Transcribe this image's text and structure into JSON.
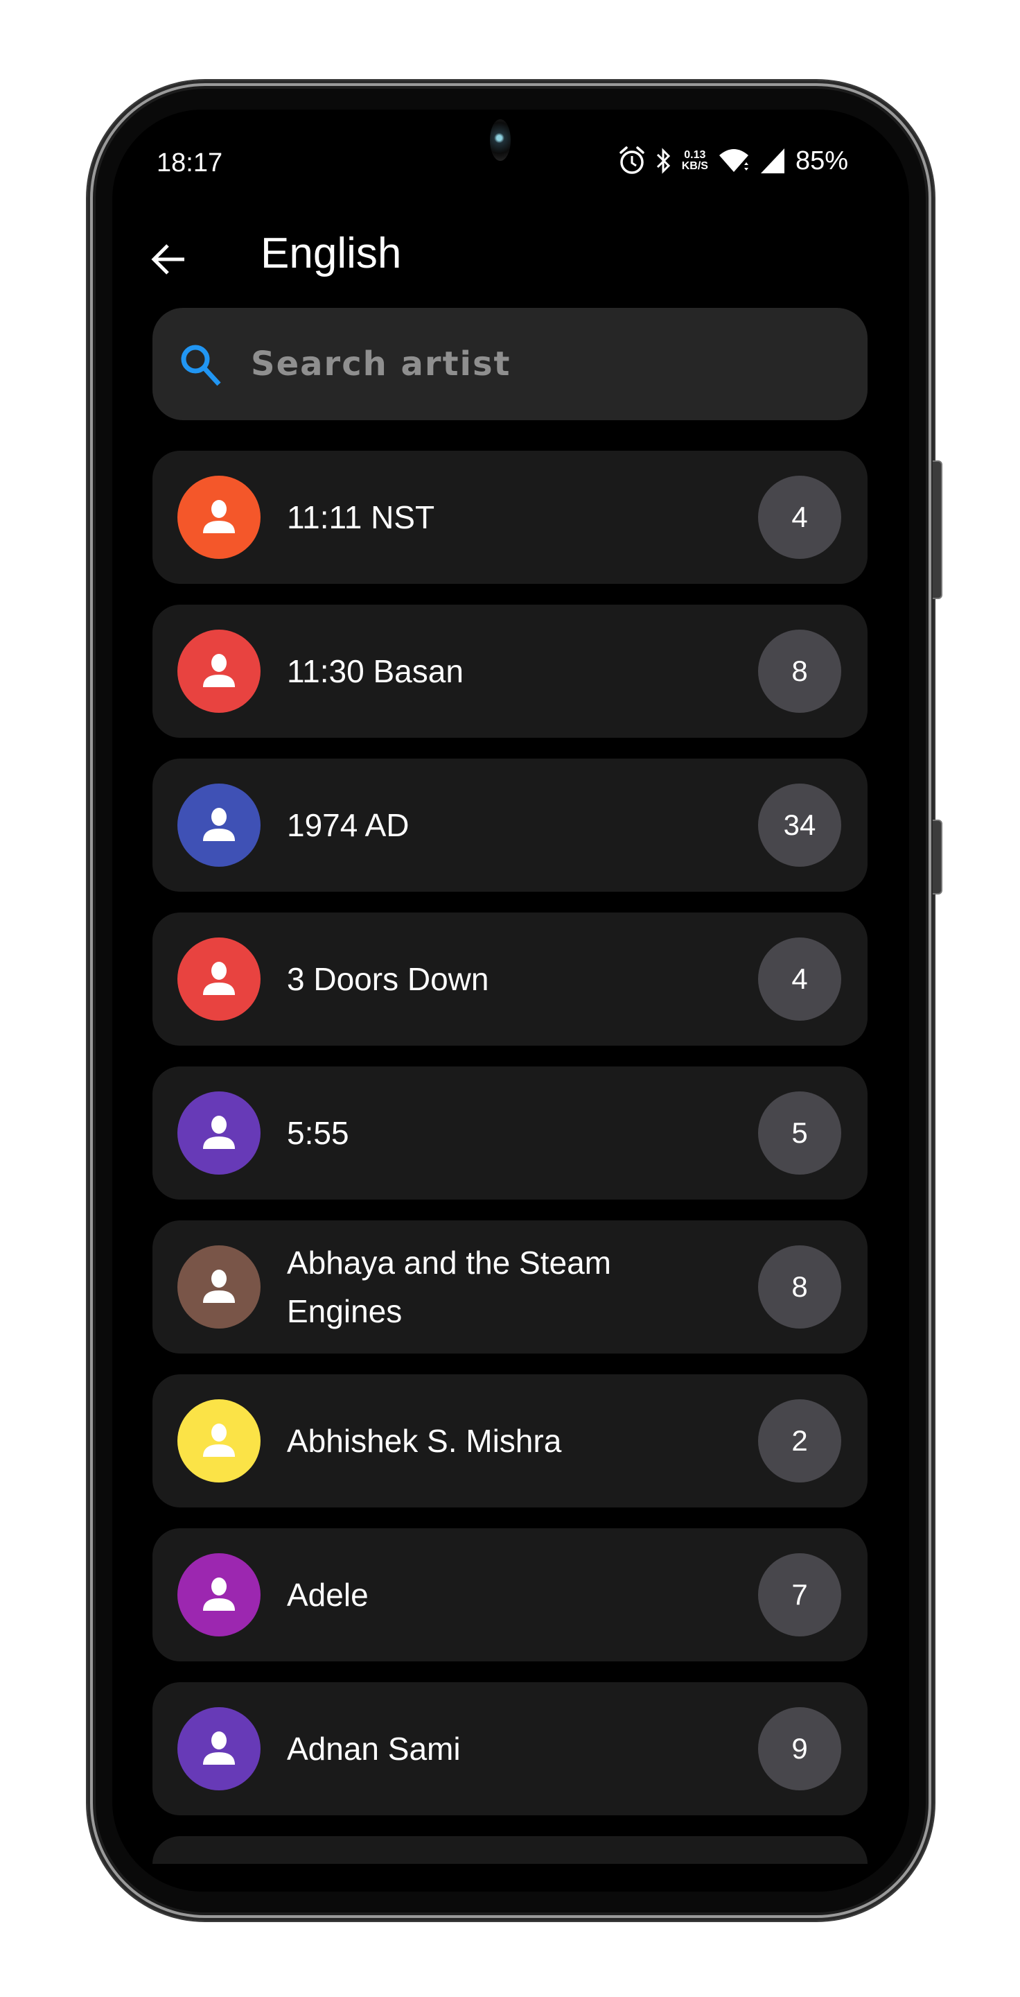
{
  "status_bar": {
    "time": "18:17",
    "icons": [
      "alarm-icon",
      "bluetooth-icon",
      "wifi-icon",
      "cell-signal-icon"
    ],
    "net_speed_value": "0.13",
    "net_speed_unit": "KB/S",
    "battery": "85%"
  },
  "app_bar": {
    "back_icon": "arrow-left-icon",
    "title": "English"
  },
  "search": {
    "icon": "search-icon",
    "placeholder": "Search artist",
    "value": "",
    "icon_color": "#2196f3"
  },
  "artists": [
    {
      "name": "11:11 NST",
      "count": "4",
      "avatar_color": "#f4572a"
    },
    {
      "name": "11:30 Basan",
      "count": "8",
      "avatar_color": "#e84340"
    },
    {
      "name": "1974 AD",
      "count": "34",
      "avatar_color": "#3f51b5"
    },
    {
      "name": "3 Doors Down",
      "count": "4",
      "avatar_color": "#e84340"
    },
    {
      "name": "5:55",
      "count": "5",
      "avatar_color": "#673ab7"
    },
    {
      "name": "Abhaya and the Steam Engines",
      "count": "8",
      "avatar_color": "#795548"
    },
    {
      "name": "Abhishek S. Mishra",
      "count": "2",
      "avatar_color": "#fbe347"
    },
    {
      "name": "Adele",
      "count": "7",
      "avatar_color": "#9c27b0"
    },
    {
      "name": "Adnan Sami",
      "count": "9",
      "avatar_color": "#673ab7"
    }
  ]
}
